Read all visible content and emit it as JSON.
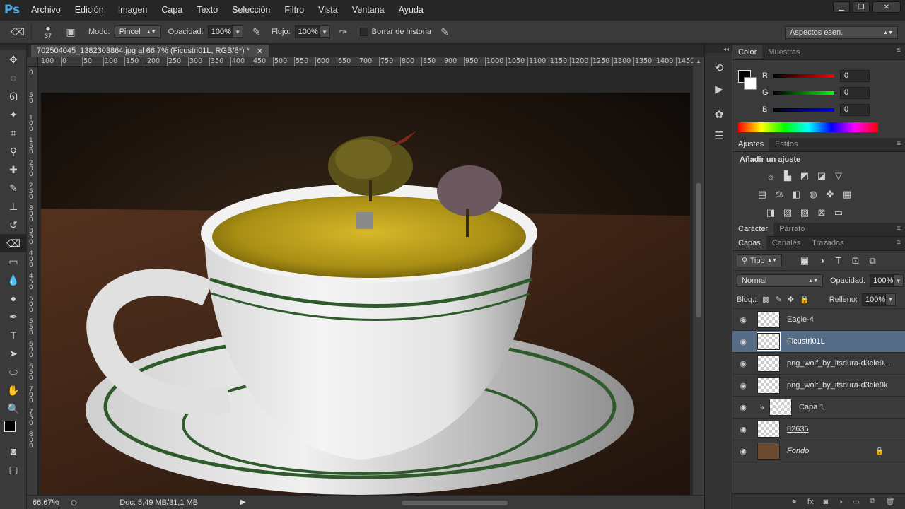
{
  "app": {
    "logo_text": "Ps",
    "menu": [
      "Archivo",
      "Edición",
      "Imagen",
      "Capa",
      "Texto",
      "Selección",
      "Filtro",
      "Vista",
      "Ventana",
      "Ayuda"
    ]
  },
  "options_bar": {
    "brush_size": "37",
    "mode_label": "Modo:",
    "mode_value": "Pincel",
    "opacity_label": "Opacidad:",
    "opacity_value": "100%",
    "flow_label": "Flujo:",
    "flow_value": "100%",
    "history_label": "Borrar de historia",
    "workspace": "Aspectos esen."
  },
  "document": {
    "tab_title": "702504045_1382303864.jpg al 66,7% (Ficustri01L, RGB/8*) *",
    "ruler_top": [
      "100",
      "0",
      "50",
      "100",
      "150",
      "200",
      "250",
      "300",
      "350",
      "400",
      "450",
      "500",
      "550",
      "600",
      "650",
      "700",
      "750",
      "800",
      "850",
      "900",
      "950",
      "1000",
      "1050",
      "1100",
      "1150",
      "1200",
      "1250",
      "1300",
      "1350",
      "1400",
      "1450"
    ],
    "ruler_left": [
      "0",
      "50",
      "100",
      "150",
      "200",
      "250",
      "300",
      "350",
      "400",
      "450",
      "500",
      "550",
      "600",
      "650",
      "700",
      "750",
      "800"
    ],
    "zoom": "66,67%",
    "doc_size": "Doc: 5,49 MB/31,1 MB"
  },
  "color_panel": {
    "tabs": [
      "Color",
      "Muestras"
    ],
    "channels": [
      {
        "label": "R",
        "value": "0",
        "color": "#ff0000"
      },
      {
        "label": "G",
        "value": "0",
        "color": "#00ff00"
      },
      {
        "label": "B",
        "value": "0",
        "color": "#0000ff"
      }
    ]
  },
  "adjustments_panel": {
    "tabs": [
      "Ajustes",
      "Estilos"
    ],
    "heading": "Añadir un ajuste"
  },
  "char_panel": {
    "tabs": [
      "Carácter",
      "Párrafo"
    ]
  },
  "layers_panel": {
    "tabs": [
      "Capas",
      "Canales",
      "Trazados"
    ],
    "filter_kind": "Tipo",
    "blend_mode": "Normal",
    "opacity_label": "Opacidad:",
    "opacity_value": "100%",
    "lock_label": "Bloq.:",
    "fill_label": "Relleno:",
    "fill_value": "100%",
    "layers": [
      {
        "name": "Eagle-4",
        "selected": false
      },
      {
        "name": "Ficustri01L",
        "selected": true
      },
      {
        "name": "png_wolf_by_itsdura-d3cle9...",
        "selected": false
      },
      {
        "name": "png_wolf_by_itsdura-d3cle9k",
        "selected": false
      },
      {
        "name": "Capa 1",
        "selected": false
      },
      {
        "name": "82635",
        "selected": false
      },
      {
        "name": "Fondo",
        "selected": false
      }
    ]
  }
}
